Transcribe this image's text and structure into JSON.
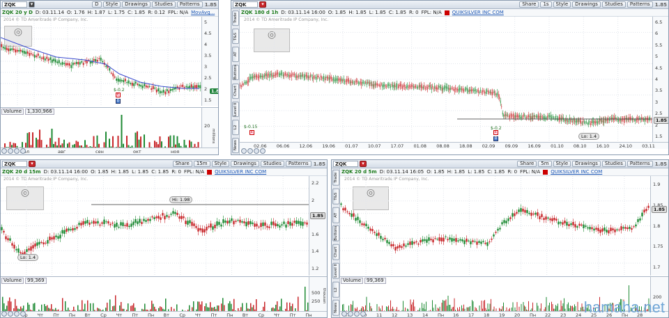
{
  "panes": [
    {
      "symbol": "ZQK",
      "buttons": [
        "D",
        "Style",
        "Drawings",
        "Studies",
        "Patterns"
      ],
      "price": "1.85",
      "info": {
        "period": "ZQK 20 y D",
        "d": "D: 03.11.14",
        "o": "O: 1.76",
        "h": "H: 1.87",
        "l": "L: 1.75",
        "c": "C: 1.85",
        "r": "R: 0.12",
        "fpl": "FPL: N/A",
        "study": "MovAvg..."
      },
      "copyright": "2014 © TD Ameritrade IP Company, Inc.",
      "y_ticks": [
        "5",
        "4.5",
        "4",
        "3.5",
        "3",
        "2.5",
        "2",
        "1.5"
      ],
      "price_tag": "1.85",
      "volume": {
        "label": "Volume",
        "value": "1,330,966",
        "ticks": [
          "20"
        ],
        "unit": "millions"
      },
      "x_ticks": [
        "мол",
        "авг",
        "сен",
        "окт",
        "ноя"
      ],
      "event": "$-0.2"
    },
    {
      "symbol": "ZQK",
      "buttons": [
        "1s",
        "Style",
        "Drawings",
        "Studies",
        "Patterns"
      ],
      "price": "1.85",
      "info": {
        "period": "ZQK 180 d 1h",
        "d": "D: 03.11.14 16:00",
        "o": "O: 1.85",
        "h": "H: 1.85",
        "l": "L: 1.85",
        "c": "C: 1.85",
        "r": "R: 0",
        "fpl": "FPL: N/A",
        "company": "QUIKSILVER INC COM"
      },
      "copyright": "2014 © TD Ameritrade IP Company, Inc.",
      "y_ticks": [
        "6.5",
        "6",
        "5.5",
        "5",
        "4.5",
        "4",
        "3.5",
        "3",
        "2.5",
        "2",
        "1.5"
      ],
      "price_tag": "1.85",
      "low_label": "Lo: 1.4",
      "x_ticks": [
        "02.06",
        "06.06",
        "12.06",
        "19.06",
        "01.07",
        "10.07",
        "17.07",
        "01.08",
        "08.08",
        "18.08",
        "02.09",
        "09.09",
        "16.09",
        "01.10",
        "08.10",
        "16.10",
        "24.10",
        "03.11"
      ],
      "events": [
        "$-0.15",
        "$-0.2"
      ],
      "side_tabs": [
        "Trade",
        "T&S",
        "AT",
        "Buttons",
        "Chart",
        "Level II",
        "L2",
        "News"
      ]
    },
    {
      "symbol": "ZQK",
      "buttons": [
        "15m",
        "Style",
        "Drawings",
        "Studies",
        "Patterns"
      ],
      "price": "1.85",
      "info": {
        "period": "ZQK 20 d 15m",
        "d": "D: 03.11.14 16:00",
        "o": "O: 1.85",
        "h": "H: 1.85",
        "l": "L: 1.85",
        "c": "C: 1.85",
        "r": "R: 0",
        "fpl": "FPL: N/A",
        "company": "QUIKSILVER INC COM"
      },
      "copyright": "2014 © TD Ameritrade IP Company, Inc.",
      "y_ticks": [
        "2.2",
        "2",
        "1.8",
        "1.6",
        "1.4",
        "1.2"
      ],
      "price_tag": "1.85",
      "high_label": "Hi: 1.98",
      "low_label": "Lo: 1.4",
      "volume": {
        "label": "Volume",
        "value": "99,369",
        "ticks": [
          "500",
          "250"
        ],
        "unit": "thousan"
      },
      "x_ticks": [
        "Ср",
        "Чт",
        "Пт",
        "Пн",
        "Вт",
        "Ср",
        "Чт",
        "Пт",
        "Пн",
        "Вт",
        "Ср",
        "Чт",
        "Пт",
        "Пн",
        "Вт",
        "Ср",
        "Чт",
        "Пт",
        "Пн"
      ]
    },
    {
      "symbol": "ZQK",
      "buttons": [
        "5m",
        "Style",
        "Drawings",
        "Studies",
        "Patterns"
      ],
      "price": "1.85",
      "info": {
        "period": "ZQK 20 d 5m",
        "d": "D: 03.11.14 16:05",
        "o": "O: 1.85",
        "h": "H: 1.85",
        "l": "L: 1.85",
        "c": "C: 1.85",
        "r": "R: 0",
        "fpl": "FPL: N/A",
        "company": "QUIKSILVER INC COM"
      },
      "copyright": "2014 © TD Ameritrade IP Company, Inc.",
      "y_ticks": [
        "1.9",
        "1.85",
        "1.8",
        "1.75",
        "1.7"
      ],
      "price_tag": "1.85",
      "volume": {
        "label": "Volume",
        "value": "99,369",
        "ticks": [
          "200"
        ],
        "unit": ""
      },
      "x_ticks": [
        "Пт",
        "10",
        "11",
        "12",
        "13",
        "14",
        "Пн",
        "16",
        "17",
        "18",
        "19",
        "20",
        "Пн",
        "22",
        "23",
        "24",
        "25",
        "26",
        "Пн",
        "28"
      ],
      "side_tabs": [
        "Trade",
        "T&S",
        "AT",
        "Buttons",
        "Chart",
        "Level II",
        "L2",
        "News"
      ]
    }
  ],
  "watermark": "hamaha.net",
  "colors": {
    "up": "#1d8a33",
    "down": "#c8262a",
    "ma": "#3a4bd0",
    "bg_bar": "#d5dde8",
    "price_tag": "#20833b"
  }
}
